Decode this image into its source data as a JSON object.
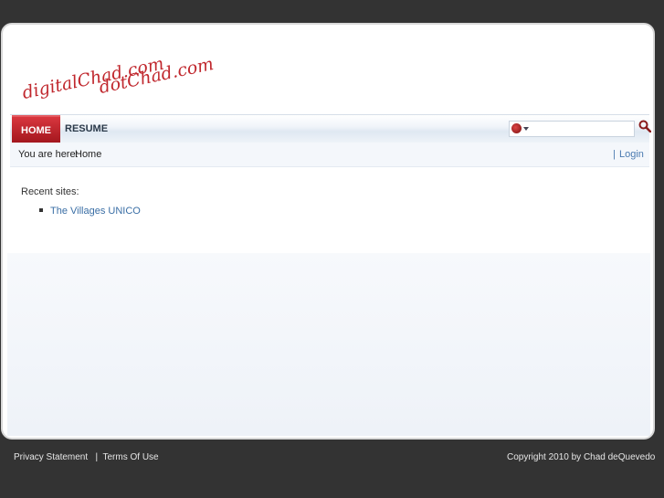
{
  "logo": {
    "line1": "digitalChad.com",
    "line2": "dotChad.com"
  },
  "nav": {
    "home": "HOME",
    "resume": "RESUME"
  },
  "search": {
    "placeholder": "",
    "flag_icon": "flag-icon",
    "button_icon": "magnifier-icon"
  },
  "breadcrumb": {
    "label": "You are here:",
    "current": "Home"
  },
  "auth": {
    "separator": "|",
    "login": "Login"
  },
  "recent": {
    "label": "Recent sites:",
    "items": [
      "The Villages UNICO"
    ]
  },
  "footer": {
    "privacy": "Privacy Statement",
    "separator": "|",
    "terms": "Terms Of Use",
    "copyright": "Copyright 2010 by Chad deQuevedo"
  },
  "colors": {
    "accent": "#c0272d",
    "link": "#3a6ea5",
    "background": "#333333"
  }
}
